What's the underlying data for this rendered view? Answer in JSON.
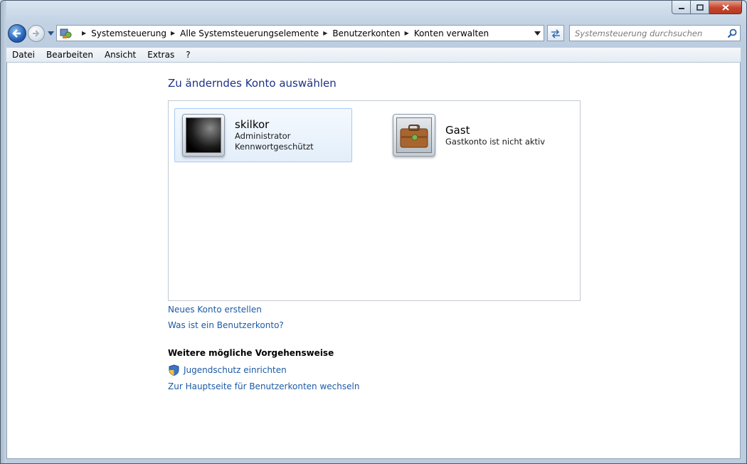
{
  "window": {
    "caption_buttons": {
      "minimize": "▭",
      "maximize": "□",
      "close": "✕"
    }
  },
  "nav": {
    "breadcrumbs": [
      "Systemsteuerung",
      "Alle Systemsteuerungselemente",
      "Benutzerkonten",
      "Konten verwalten"
    ],
    "search_placeholder": "Systemsteuerung durchsuchen"
  },
  "menu": [
    "Datei",
    "Bearbeiten",
    "Ansicht",
    "Extras",
    "?"
  ],
  "main": {
    "heading": "Zu änderndes Konto auswählen",
    "accounts": [
      {
        "name": "skilkor",
        "line1": "Administrator",
        "line2": "Kennwortgeschützt",
        "selected": true,
        "icon": "dark-user-picture-icon"
      },
      {
        "name": "Gast",
        "line1": "Gastkonto ist nicht aktiv",
        "line2": "",
        "selected": false,
        "icon": "guest-suitcase-icon"
      }
    ],
    "links": [
      "Neues Konto erstellen",
      "Was ist ein Benutzerkonto?"
    ],
    "more_title": "Weitere mögliche Vorgehensweise",
    "tasks": [
      "Jugendschutz einrichten",
      "Zur Hauptseite für Benutzerkonten wechseln"
    ]
  },
  "colors": {
    "link": "#1c5aa5",
    "heading": "#1e3287",
    "selection_border": "#a8cbef"
  }
}
